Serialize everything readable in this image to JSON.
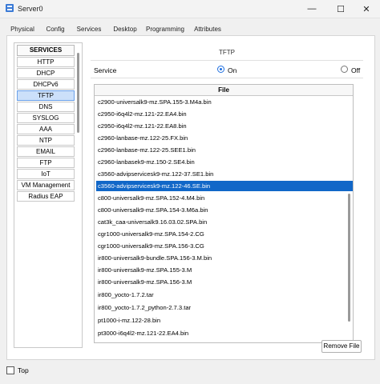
{
  "window": {
    "title": "Server0",
    "minimize_glyph": "—",
    "maximize_glyph": "☐",
    "close_glyph": "✕"
  },
  "tabs": [
    "Physical",
    "Config",
    "Services",
    "Desktop",
    "Programming",
    "Attributes"
  ],
  "active_tab": "Services",
  "services": {
    "header": "SERVICES",
    "items": [
      "HTTP",
      "DHCP",
      "DHCPv6",
      "TFTP",
      "DNS",
      "SYSLOG",
      "AAA",
      "NTP",
      "EMAIL",
      "FTP",
      "IoT",
      "VM Management",
      "Radius EAP"
    ],
    "selected": "TFTP"
  },
  "tftp": {
    "title": "TFTP",
    "service_label": "Service",
    "on_label": "On",
    "off_label": "Off",
    "service_state": "On",
    "file_header": "File",
    "files": [
      "c2900-universalk9-mz.SPA.155-3.M4a.bin",
      "c2950-i6q4l2-mz.121-22.EA4.bin",
      "c2950-i6q4l2-mz.121-22.EA8.bin",
      "c2960-lanbase-mz.122-25.FX.bin",
      "c2960-lanbase-mz.122-25.SEE1.bin",
      "c2960-lanbasek9-mz.150-2.SE4.bin",
      "c3560-advipservicesk9-mz.122-37.SE1.bin",
      "c3560-advipservicesk9-mz.122-46.SE.bin",
      "c800-universalk9-mz.SPA.152-4.M4.bin",
      "c800-universalk9-mz.SPA.154-3.M6a.bin",
      "cat3k_caa-universalk9.16.03.02.SPA.bin",
      "cgr1000-universalk9-mz.SPA.154-2.CG",
      "cgr1000-universalk9-mz.SPA.156-3.CG",
      "ir800-universalk9-bundle.SPA.156-3.M.bin",
      "ir800-universalk9-mz.SPA.155-3.M",
      "ir800-universalk9-mz.SPA.156-3.M",
      "ir800_yocto-1.7.2.tar",
      "ir800_yocto-1.7.2_python-2.7.3.tar",
      "pt1000-i-mz.122-28.bin",
      "pt3000-i6q4l2-mz.121-22.EA4.bin"
    ],
    "selected_file": "c3560-advipservicesk9-mz.122-46.SE.bin",
    "remove_button": "Remove File"
  },
  "footer": {
    "top_label": "Top",
    "top_checked": false
  }
}
